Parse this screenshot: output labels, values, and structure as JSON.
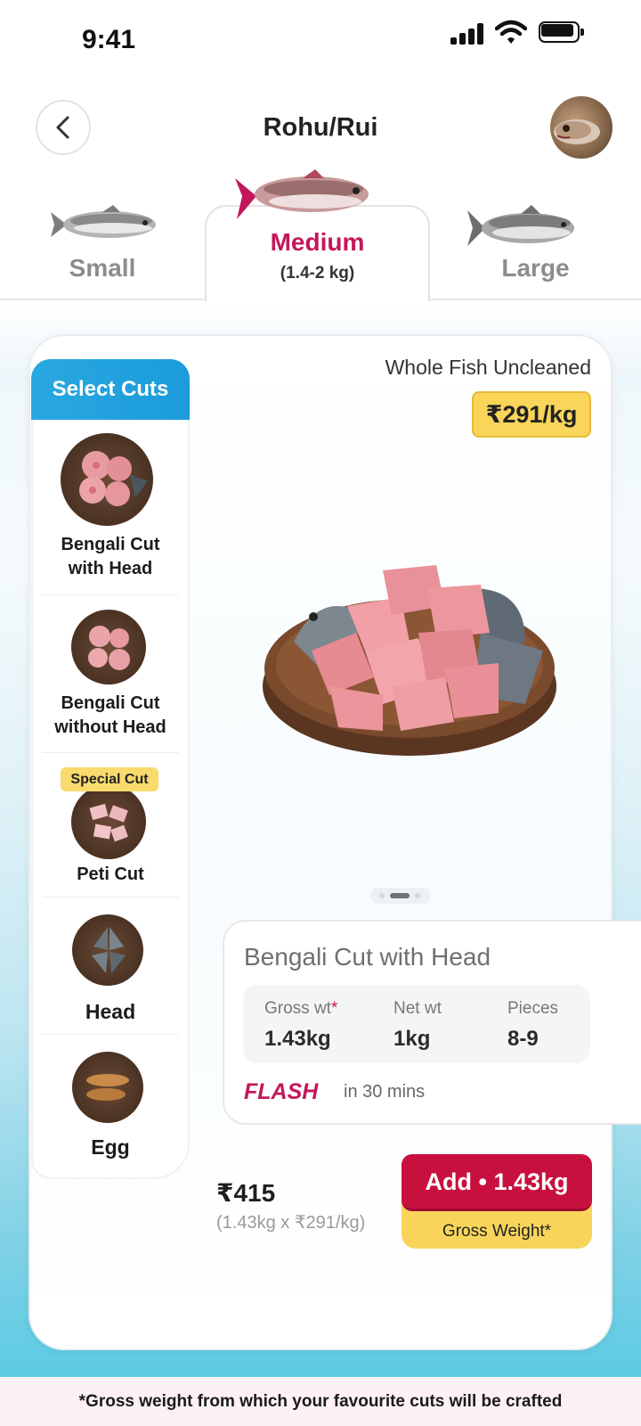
{
  "status_bar": {
    "time": "9:41"
  },
  "header": {
    "title": "Rohu/Rui"
  },
  "size_tabs": [
    {
      "label": "Small",
      "selected": false
    },
    {
      "label": "Medium",
      "sublabel": "(1.4-2 kg)",
      "selected": true
    },
    {
      "label": "Large",
      "selected": false
    }
  ],
  "cuts": {
    "header": "Select Cuts",
    "items": [
      {
        "label_line1": "Bengali Cut",
        "label_line2": "with Head",
        "selected": true
      },
      {
        "label_line1": "Bengali Cut",
        "label_line2": "without Head",
        "selected": false
      },
      {
        "label_line1": "Peti Cut",
        "badge": "Special Cut",
        "selected": false
      },
      {
        "label_line1": "Head",
        "selected": false
      },
      {
        "label_line1": "Egg",
        "selected": false
      }
    ]
  },
  "product": {
    "type": "Whole Fish Uncleaned",
    "price_per_kg": "₹291/kg",
    "carousel": {
      "count": 3,
      "active": 1
    }
  },
  "details": {
    "title": "Bengali Cut with Head",
    "gross_wt_label": "Gross wt",
    "gross_wt_marker": "*",
    "gross_wt_value": "1.43kg",
    "net_wt_label": "Net wt",
    "net_wt_value": "1kg",
    "pieces_label": "Pieces",
    "pieces_value": "8-9",
    "delivery_brand": "FLASH",
    "delivery_time": "in 30 mins"
  },
  "cart": {
    "total": "₹415",
    "calc": "(1.43kg x ₹291/kg)",
    "add_label": "Add • 1.43kg",
    "add_sublabel": "Gross Weight*"
  },
  "footer": {
    "note": "*Gross weight from which your favourite cuts will be crafted"
  },
  "colors": {
    "accent": "#c2185b",
    "add_button": "#c8103f",
    "price_badge": "#f9d55a",
    "cuts_header": "#1b9bdc"
  }
}
